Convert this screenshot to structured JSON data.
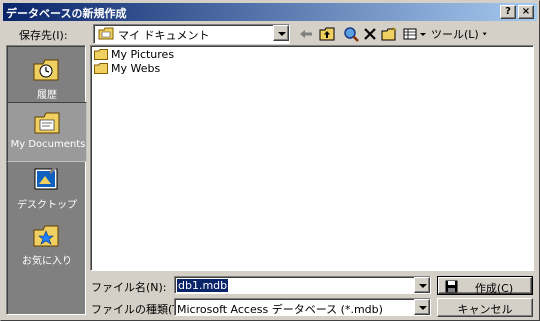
{
  "window": {
    "title": "データベースの新規作成",
    "help_label": "?",
    "close_label": "×"
  },
  "lookin": {
    "label": "保存先(I):",
    "value": "マイ ドキュメント"
  },
  "toolbar": {
    "back_icon": "back-arrow-icon",
    "up_icon": "up-folder-icon",
    "search_icon": "search-web-icon",
    "delete_icon": "delete-icon",
    "newfolder_icon": "new-folder-icon",
    "views_icon": "views-icon",
    "tools_label": "ツール(L)"
  },
  "places": [
    {
      "label": "履歴",
      "icon": "history-icon"
    },
    {
      "label": "My Documents",
      "icon": "my-documents-icon"
    },
    {
      "label": "デスクトップ",
      "icon": "desktop-icon"
    },
    {
      "label": "お気に入り",
      "icon": "favorites-icon"
    }
  ],
  "files": [
    {
      "name": "My Pictures",
      "icon": "folder-icon"
    },
    {
      "name": "My Webs",
      "icon": "folder-icon"
    }
  ],
  "filename": {
    "label": "ファイル名(N):",
    "value": "db1.mdb"
  },
  "filetype": {
    "label": "ファイルの種類(T):",
    "value": "Microsoft Access データベース (*.mdb)"
  },
  "buttons": {
    "create_label": "作成(C)",
    "cancel_label": "キャンセル"
  },
  "colors": {
    "titlebar_start": "#0a246a",
    "titlebar_end": "#a6caf0",
    "face": "#d4d0c8",
    "places_bg": "#808080",
    "selection": "#0a246a",
    "folder": "#f0d060"
  }
}
